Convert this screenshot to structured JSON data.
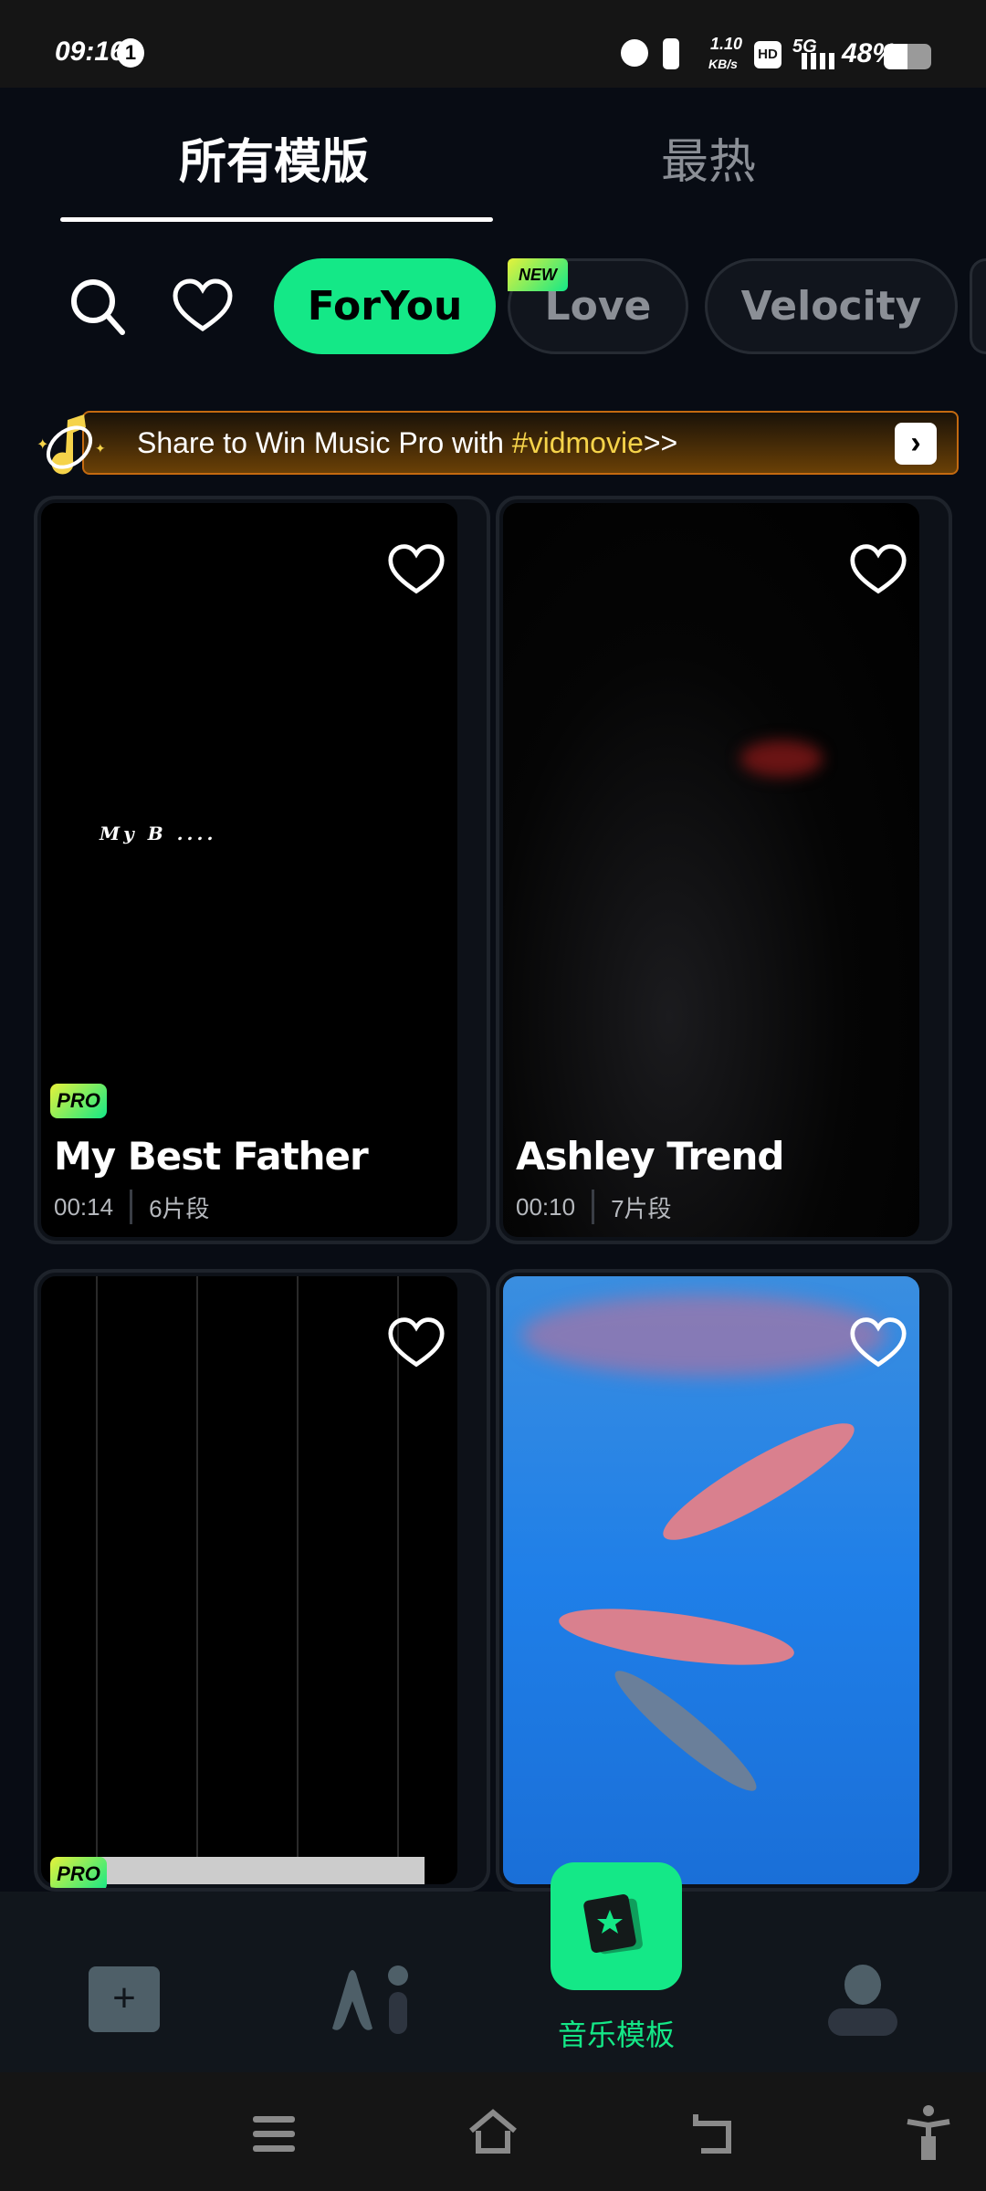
{
  "status": {
    "time": "09:16",
    "notif_count": "1",
    "net_speed": "1.10",
    "net_unit": "KB/s",
    "hd": "HD",
    "network": "5G",
    "battery": "48%"
  },
  "tabs": [
    {
      "label": "所有模版",
      "active": true
    },
    {
      "label": "最热",
      "active": false
    }
  ],
  "chips": [
    {
      "label": "ForYou",
      "active": true
    },
    {
      "label": "Love",
      "badge": "NEW"
    },
    {
      "label": "Velocity"
    }
  ],
  "banner": {
    "text": "Share to Win Music Pro with ",
    "hashtag": "#vidmovie",
    "suffix": ">>"
  },
  "cards": [
    {
      "title": "My Best Father",
      "duration": "00:14",
      "clips": "6片段",
      "pro": "PRO",
      "overlay_text": "My B ...."
    },
    {
      "title": "Ashley Trend",
      "duration": "00:10",
      "clips": "7片段"
    },
    {
      "pro": "PRO"
    },
    {}
  ],
  "nav": {
    "center_label": "音乐模板"
  },
  "colors": {
    "accent": "#14e887",
    "hashtag": "#f5d34a",
    "background": "#080c14"
  }
}
